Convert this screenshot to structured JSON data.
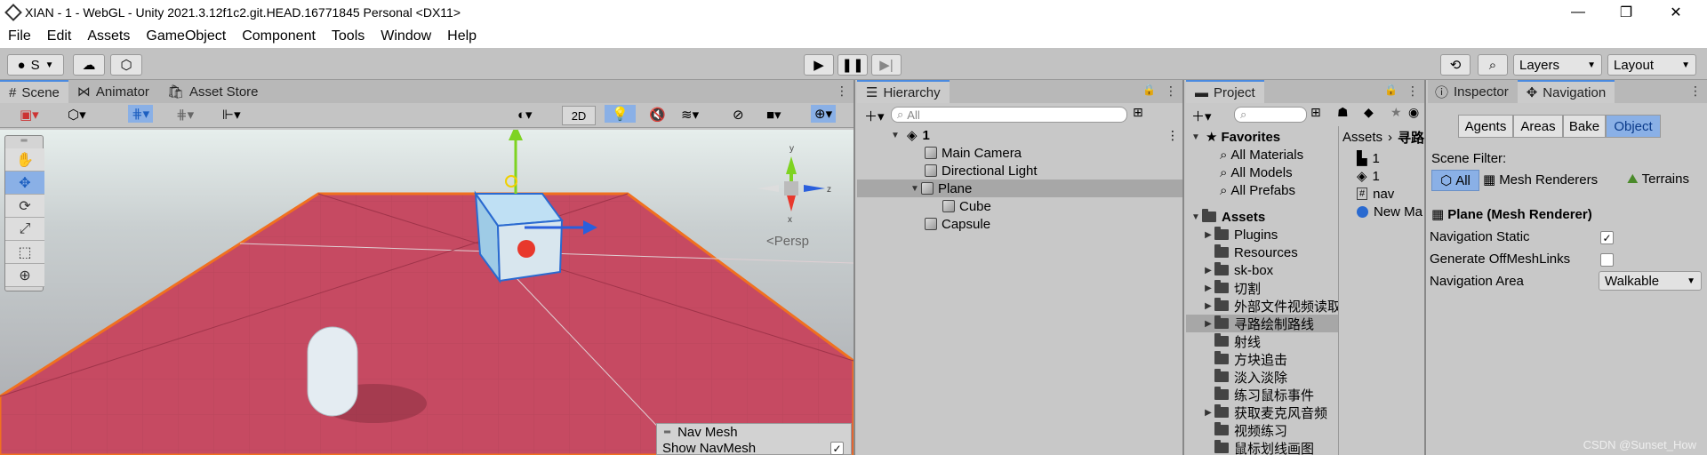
{
  "window": {
    "title": "XIAN - 1 - WebGL - Unity 2021.3.12f1c2.git.HEAD.16771845 Personal <DX11>"
  },
  "menu": [
    "File",
    "Edit",
    "Assets",
    "GameObject",
    "Component",
    "Tools",
    "Window",
    "Help"
  ],
  "toolbar": {
    "account_label": "S",
    "layers_label": "Layers",
    "layout_label": "Layout"
  },
  "scene_panel": {
    "tabs": [
      "Scene",
      "Animator",
      "Asset Store"
    ],
    "mode_2d": "2D",
    "persp_label": "<Persp",
    "axis_y": "y",
    "axis_x": "x",
    "axis_z": "z",
    "navmesh_overlay": {
      "title": "Nav Mesh",
      "show_label": "Show NavMesh"
    }
  },
  "hierarchy": {
    "tab": "Hierarchy",
    "search_placeholder": "All",
    "scene_name": "1",
    "items": [
      "Main Camera",
      "Directional Light",
      "Plane",
      "Cube",
      "Capsule"
    ]
  },
  "project": {
    "tab": "Project",
    "favorites_label": "Favorites",
    "favorites": [
      "All Materials",
      "All Models",
      "All Prefabs"
    ],
    "assets_label": "Assets",
    "folders": [
      "Plugins",
      "Resources",
      "sk-box",
      "切割",
      "外部文件视频读取",
      "寻路绘制路线",
      "射线",
      "方块追击",
      "淡入淡除",
      "练习鼠标事件",
      "获取麦克风音频",
      "视频练习",
      "鼠标划线画图"
    ],
    "breadcrumb": [
      "Assets",
      "寻路"
    ],
    "files": [
      "1",
      "1",
      "nav",
      "New Ma"
    ]
  },
  "inspector": {
    "tabs": [
      "Inspector",
      "Navigation"
    ],
    "buttons": [
      "Agents",
      "Areas",
      "Bake",
      "Object"
    ],
    "scene_filter_label": "Scene Filter:",
    "filters": [
      "All",
      "Mesh Renderers",
      "Terrains"
    ],
    "object_title": "Plane (Mesh Renderer)",
    "nav_static_label": "Navigation Static",
    "nav_static_checked": "✓",
    "offmesh_label": "Generate OffMeshLinks",
    "area_label": "Navigation Area",
    "area_value": "Walkable"
  },
  "watermark": "CSDN @Sunset_How",
  "colors": {
    "accent": "#4a8ae0",
    "selection": "#a7a7a7",
    "plane": "#c64a62",
    "sky": "#dfe8e6"
  }
}
